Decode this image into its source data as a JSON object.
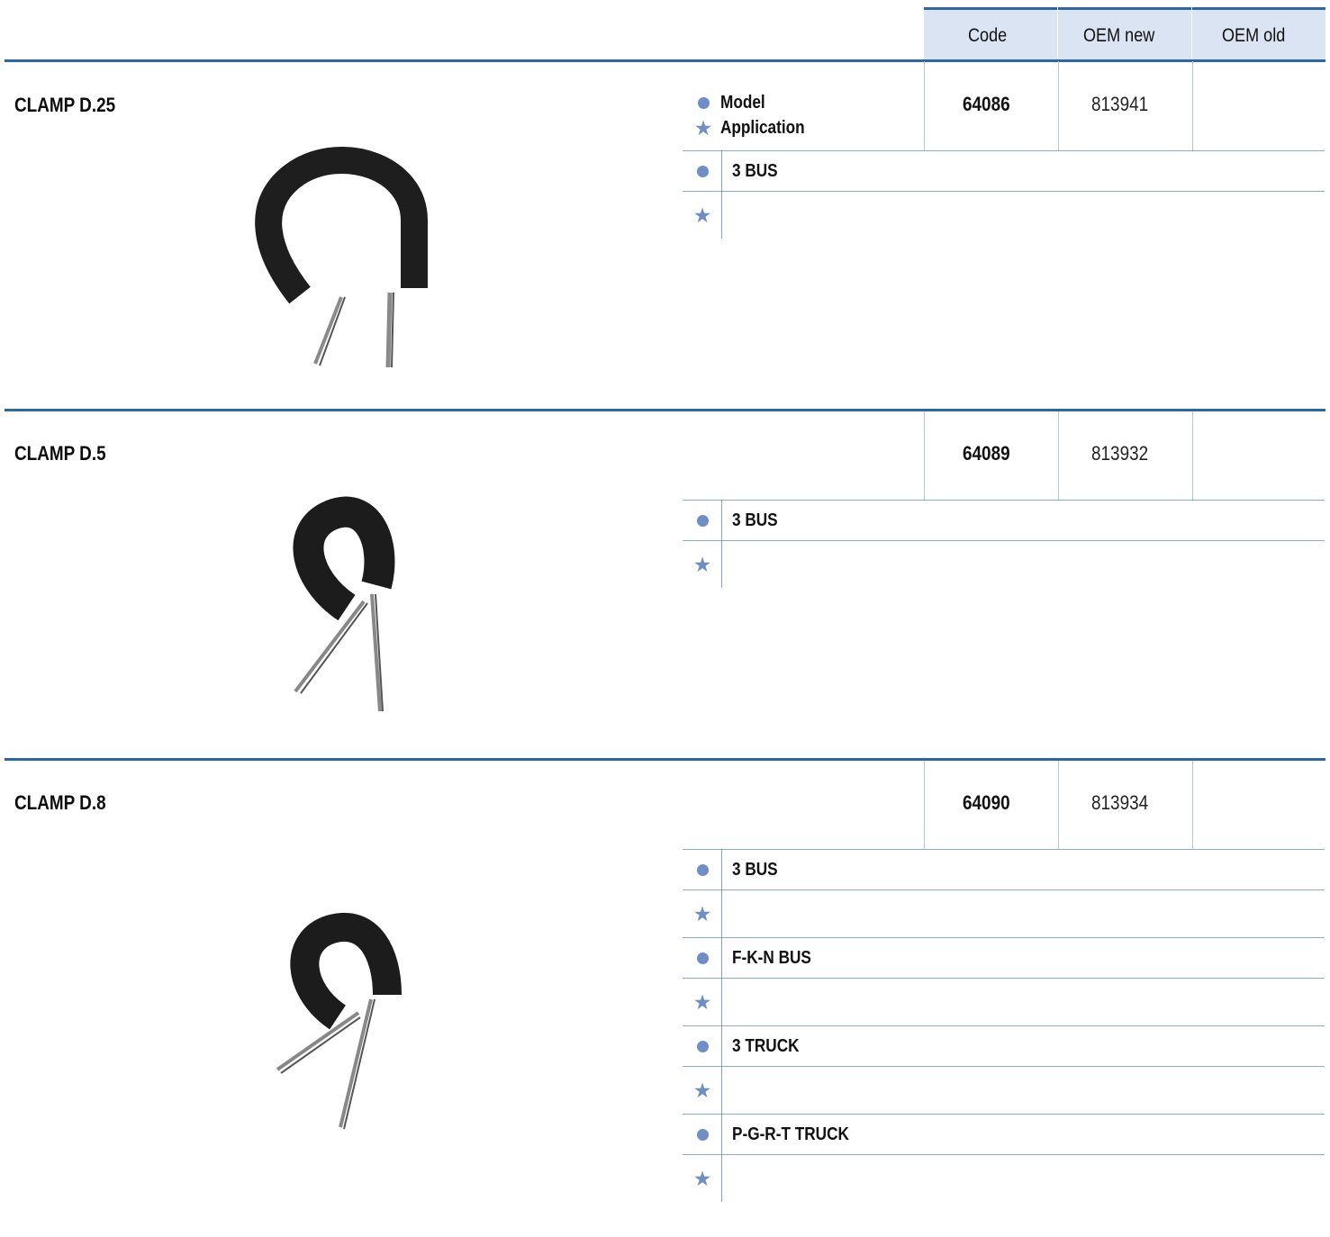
{
  "header": {
    "code": "Code",
    "oem_new": "OEM new",
    "oem_old": "OEM old"
  },
  "legend": {
    "model": "Model",
    "application": "Application"
  },
  "icons": {
    "model": "circle-icon",
    "application": "star-icon"
  },
  "colors": {
    "accent": "#2b67a6",
    "header_bg": "#dbe4f3",
    "bullet": "#6f8dc7"
  },
  "products": [
    {
      "title": "CLAMP D.25",
      "code": "64086",
      "oem_new": "813941",
      "oem_old": "",
      "applications": [
        "3 BUS"
      ]
    },
    {
      "title": "CLAMP D.5",
      "code": "64089",
      "oem_new": "813932",
      "oem_old": "",
      "applications": [
        "3 BUS"
      ]
    },
    {
      "title": "CLAMP D.8",
      "code": "64090",
      "oem_new": "813934",
      "oem_old": "",
      "applications": [
        "3 BUS",
        "F-K-N BUS",
        "3 TRUCK",
        "P-G-R-T TRUCK"
      ]
    }
  ]
}
